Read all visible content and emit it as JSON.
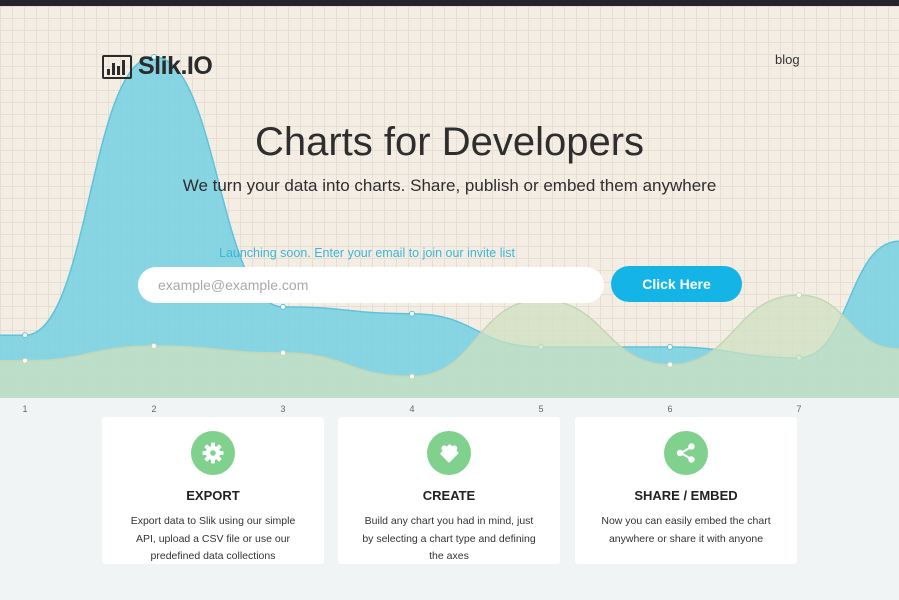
{
  "brand": {
    "name": "Slik.IO"
  },
  "nav": {
    "blog": "blog"
  },
  "hero": {
    "title": "Charts for Developers",
    "subtitle": "We turn your data into charts. Share, publish or embed them anywhere",
    "launch_note": "Launching soon. Enter your email to join our invite list",
    "email_placeholder": "example@example.com",
    "button_label": "Click Here"
  },
  "colors": {
    "series_blue": "#6fcfe3",
    "series_green": "#cfe0c0",
    "accent": "#14b5e6",
    "feature_icon_bg": "#7fd18d"
  },
  "chart_data": {
    "type": "area",
    "x": [
      1,
      2,
      3,
      4,
      5,
      6,
      7
    ],
    "series": [
      {
        "values": [
          6.4,
          34.8,
          9.3,
          8.6,
          5.2,
          5.2,
          4.1
        ]
      },
      {
        "values": [
          3.8,
          5.3,
          4.6,
          2.2,
          10.0,
          3.4,
          10.5
        ]
      }
    ],
    "ylim": [
      0,
      40
    ],
    "grid": true,
    "xlabel": "",
    "ylabel": ""
  },
  "features": [
    {
      "icon": "gear-icon",
      "title": "EXPORT",
      "description": "Export data to Slik using our simple API, upload a CSV file or use our predefined data collections"
    },
    {
      "icon": "puzzle-icon",
      "title": "CREATE",
      "description": "Build any chart you had in mind, just by selecting a chart type and defining the axes"
    },
    {
      "icon": "share-icon",
      "title": "SHARE / EMBED",
      "description": "Now you can easily embed the chart anywhere or share it with anyone"
    }
  ]
}
